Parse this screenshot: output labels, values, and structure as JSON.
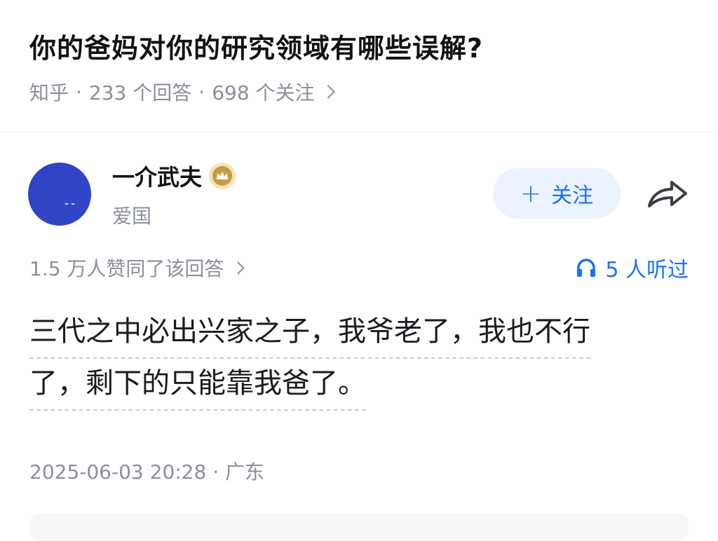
{
  "question": {
    "title": "你的爸妈对你的研究领域有哪些误解?",
    "source": "知乎",
    "answers": "233 个回答",
    "followers": "698 个关注"
  },
  "author": {
    "name": "一介武夫",
    "bio": "爱国",
    "avatar_color": "#2f44c6",
    "badge_icon": "crown-icon"
  },
  "actions": {
    "follow_label": "关注",
    "follow_icon": "plus-icon",
    "share_icon": "share-arrow-icon"
  },
  "stats": {
    "votes": "1.5 万人赞同了该回答",
    "listen": "5 人听过",
    "listen_icon": "headphones-icon"
  },
  "answer": {
    "line1": "三代之中必出兴家之子，我爷老了，我也不行",
    "line2": "了，剩下的只能靠我爸了。"
  },
  "meta": {
    "timestamp": "2025-06-03 20:28 · 广东"
  },
  "colors": {
    "accent": "#1772f6",
    "muted": "#8a8f99",
    "follow_bg": "#ebf3fe",
    "badge": "#c99a3e"
  }
}
